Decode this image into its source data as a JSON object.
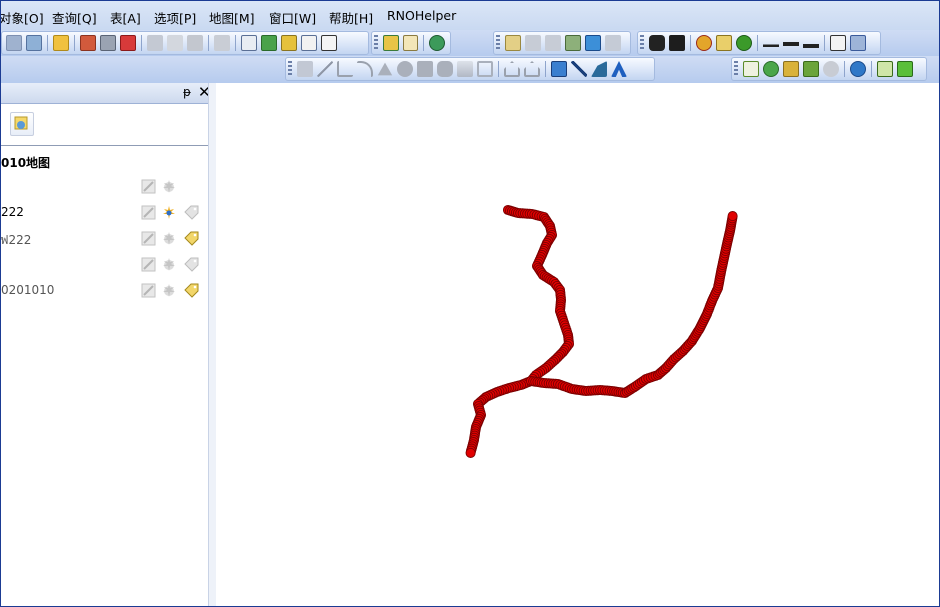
{
  "menu": [
    "对象[O]",
    "查询[Q]",
    "表[A]",
    "选项[P]",
    "地图[M]",
    "窗口[W]",
    "帮助[H]",
    "RNOHelper"
  ],
  "panel": {
    "pin_glyph": "ᵽ",
    "close_glyph": "✕",
    "layers": [
      {
        "label": "010地图",
        "bold": true
      },
      {
        "label": ""
      },
      {
        "label": "222"
      },
      {
        "label": ""
      },
      {
        "label": "0201010"
      }
    ]
  },
  "map": {
    "route_color": "#e10000",
    "outline_color": "#7a0000"
  }
}
